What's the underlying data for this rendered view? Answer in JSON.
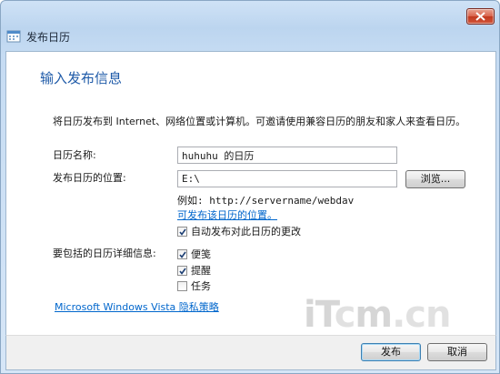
{
  "window": {
    "title": "发布日历"
  },
  "dialog": {
    "heading": "输入发布信息",
    "description": "将日历发布到 Internet、网络位置或计算机。可邀请使用兼容日历的朋友和家人来查看日历。",
    "calendar_name_label": "日历名称:",
    "calendar_name_value": "huhuhu 的日历",
    "location_label": "发布日历的位置:",
    "location_value": "E:\\",
    "browse_label": "浏览...",
    "example_text": "例如:  http://servername/webdav",
    "publishable_link": "可发布该日历的位置。",
    "auto_publish_label": "自动发布对此日历的更改",
    "auto_publish_checked": true,
    "details_label": "要包括的日历详细信息:",
    "details": [
      {
        "label": "便笺",
        "checked": true
      },
      {
        "label": "提醒",
        "checked": true
      },
      {
        "label": "任务",
        "checked": false
      }
    ],
    "privacy_link": "Microsoft Windows Vista 隐私策略"
  },
  "footer": {
    "publish_label": "发布",
    "cancel_label": "取消"
  },
  "watermark": {
    "text_a": "iT",
    "text_b": "c",
    "text_c": "m",
    "text_d": ".cn"
  }
}
